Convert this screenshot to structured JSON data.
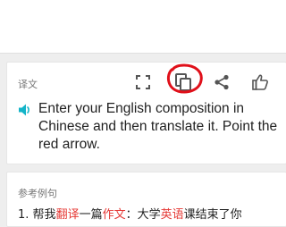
{
  "translation_card": {
    "label": "译文",
    "text": "Enter your English composition in Chinese and then translate it. Point the red arrow.",
    "tools": [
      {
        "name": "fullscreen",
        "icon": "fullscreen-icon"
      },
      {
        "name": "copy",
        "icon": "copy-icon"
      },
      {
        "name": "share",
        "icon": "share-icon"
      },
      {
        "name": "like",
        "icon": "thumbs-up-icon"
      }
    ]
  },
  "examples_card": {
    "heading": "参考例句",
    "example": {
      "number": "1.",
      "segments": [
        {
          "text": "帮我",
          "highlight": false
        },
        {
          "text": "翻译",
          "highlight": true
        },
        {
          "text": "一篇",
          "highlight": false
        },
        {
          "text": "作文",
          "highlight": true
        },
        {
          "text": "：大学",
          "highlight": false
        },
        {
          "text": "英语",
          "highlight": true
        },
        {
          "text": "课结束了你",
          "highlight": false
        }
      ]
    }
  },
  "colors": {
    "accent_speaker": "#14b4c8",
    "highlight": "#e53935",
    "annotation": "#e0101a"
  }
}
